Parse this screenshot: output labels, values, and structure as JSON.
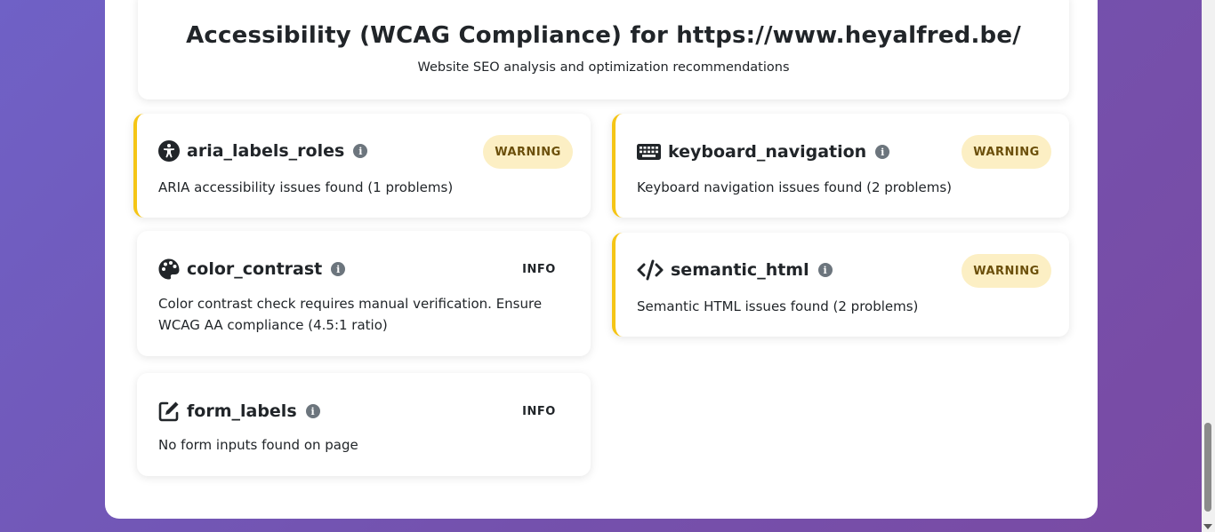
{
  "header": {
    "title": "Accessibility (WCAG Compliance) for https://www.heyalfred.be/",
    "subtitle": "Website SEO analysis and optimization recommendations"
  },
  "colors": {
    "warning_border": "#f5c516",
    "warning_badge_bg": "#fcefc4",
    "background_start": "#6f61c6",
    "background_end": "#7a4aa3"
  },
  "cards": [
    {
      "name": "aria_labels_roles",
      "icon": "universal-access-icon",
      "status": "WARNING",
      "description": "ARIA accessibility issues found (1 problems)"
    },
    {
      "name": "keyboard_navigation",
      "icon": "keyboard-icon",
      "status": "WARNING",
      "description": "Keyboard navigation issues found (2 problems)"
    },
    {
      "name": "color_contrast",
      "icon": "palette-icon",
      "status": "INFO",
      "description": "Color contrast check requires manual verification. Ensure WCAG AA compliance (4.5:1 ratio)"
    },
    {
      "name": "semantic_html",
      "icon": "code-icon",
      "status": "WARNING",
      "description": "Semantic HTML issues found (2 problems)"
    },
    {
      "name": "form_labels",
      "icon": "edit-icon",
      "status": "INFO",
      "description": "No form inputs found on page"
    }
  ],
  "info_icon_glyph": "i"
}
